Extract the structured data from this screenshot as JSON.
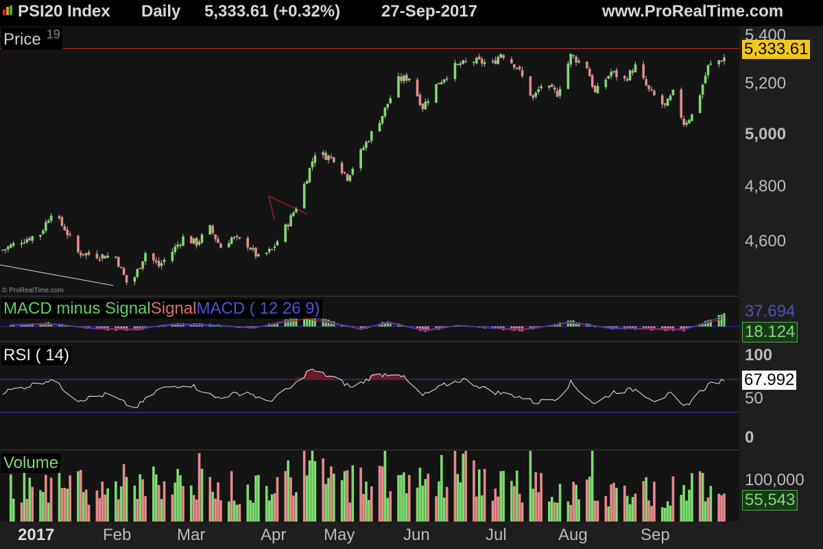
{
  "header": {
    "symbol": "PSI20 Index",
    "interval": "Daily",
    "quote": "5,333.61 (+0.32%)",
    "date": "27-Sep-2017",
    "source": "www.ProRealTime.com"
  },
  "colors": {
    "up": "#7ddc6e",
    "down": "#e88a8a",
    "background": "#141414",
    "signal": "#b02020",
    "macd": "#4040c0",
    "rsi_band": "#3a3ad0",
    "price_line": "#c03030"
  },
  "price_panel": {
    "title": "Price",
    "title_suffix": "19",
    "watermark": "© ProRealTime.com",
    "last_value": "5,333.61",
    "ticks": [
      "5,400",
      "5,200",
      "5,000",
      "4,800",
      "4,600"
    ]
  },
  "macd_panel": {
    "title_hist": "MACD minus Signal",
    "title_signal": "Signal",
    "title_macd": "MACD ( 12 26 9)",
    "tick_top": "37.694",
    "last_value": "18.124"
  },
  "rsi_panel": {
    "title": "RSI ( 14)",
    "ticks": [
      "100",
      "50",
      "0"
    ],
    "last_value": "67.992",
    "overbought": 70,
    "oversold": 30
  },
  "volume_panel": {
    "title": "Volume",
    "tick": "100,000",
    "last_value": "55,543"
  },
  "x_axis": {
    "year": "2017",
    "months": [
      "Feb",
      "Mar",
      "Apr",
      "May",
      "Jun",
      "Jul",
      "Aug",
      "Sep"
    ]
  },
  "chart_data": {
    "type": "candlestick",
    "title": "PSI20 Index",
    "x_range": [
      "2017-01-02",
      "2017-09-27"
    ],
    "price_ylim": [
      4450,
      5450
    ],
    "price_series": {
      "name": "Price",
      "points": [
        [
          "2017-01-02",
          4620
        ],
        [
          "2017-01-09",
          4655
        ],
        [
          "2017-01-16",
          4680
        ],
        [
          "2017-01-20",
          4760
        ],
        [
          "2017-01-25",
          4700
        ],
        [
          "2017-01-30",
          4610
        ],
        [
          "2017-02-06",
          4600
        ],
        [
          "2017-02-13",
          4595
        ],
        [
          "2017-02-17",
          4500
        ],
        [
          "2017-02-20",
          4520
        ],
        [
          "2017-02-24",
          4610
        ],
        [
          "2017-03-01",
          4560
        ],
        [
          "2017-03-06",
          4615
        ],
        [
          "2017-03-10",
          4665
        ],
        [
          "2017-03-15",
          4645
        ],
        [
          "2017-03-20",
          4700
        ],
        [
          "2017-03-24",
          4630
        ],
        [
          "2017-03-28",
          4665
        ],
        [
          "2017-04-03",
          4640
        ],
        [
          "2017-04-07",
          4590
        ],
        [
          "2017-04-12",
          4620
        ],
        [
          "2017-04-18",
          4720
        ],
        [
          "2017-04-21",
          4780
        ],
        [
          "2017-04-25",
          4890
        ],
        [
          "2017-04-28",
          4980
        ],
        [
          "2017-05-05",
          4960
        ],
        [
          "2017-05-10",
          4890
        ],
        [
          "2017-05-16",
          5000
        ],
        [
          "2017-05-23",
          5120
        ],
        [
          "2017-05-29",
          5250
        ],
        [
          "2017-06-02",
          5260
        ],
        [
          "2017-06-07",
          5150
        ],
        [
          "2017-06-12",
          5230
        ],
        [
          "2017-06-19",
          5300
        ],
        [
          "2017-06-26",
          5320
        ],
        [
          "2017-07-03",
          5310
        ],
        [
          "2017-07-06",
          5350
        ],
        [
          "2017-07-12",
          5300
        ],
        [
          "2017-07-18",
          5180
        ],
        [
          "2017-07-21",
          5230
        ],
        [
          "2017-07-27",
          5200
        ],
        [
          "2017-08-01",
          5340
        ],
        [
          "2017-08-07",
          5300
        ],
        [
          "2017-08-10",
          5200
        ],
        [
          "2017-08-16",
          5280
        ],
        [
          "2017-08-21",
          5250
        ],
        [
          "2017-08-25",
          5300
        ],
        [
          "2017-08-30",
          5210
        ],
        [
          "2017-09-05",
          5150
        ],
        [
          "2017-09-08",
          5200
        ],
        [
          "2017-09-12",
          5090
        ],
        [
          "2017-09-15",
          5120
        ],
        [
          "2017-09-18",
          5200
        ],
        [
          "2017-09-21",
          5300
        ],
        [
          "2017-09-27",
          5333.61
        ]
      ]
    },
    "rsi_ylim": [
      0,
      100
    ],
    "rsi_series": {
      "name": "RSI ( 14)",
      "points": [
        [
          "2017-01-02",
          55
        ],
        [
          "2017-01-09",
          60
        ],
        [
          "2017-01-20",
          70
        ],
        [
          "2017-01-30",
          45
        ],
        [
          "2017-02-10",
          52
        ],
        [
          "2017-02-20",
          35
        ],
        [
          "2017-03-01",
          58
        ],
        [
          "2017-03-12",
          65
        ],
        [
          "2017-03-22",
          48
        ],
        [
          "2017-04-03",
          55
        ],
        [
          "2017-04-10",
          42
        ],
        [
          "2017-04-20",
          62
        ],
        [
          "2017-04-26",
          82
        ],
        [
          "2017-05-05",
          72
        ],
        [
          "2017-05-12",
          60
        ],
        [
          "2017-05-20",
          75
        ],
        [
          "2017-05-29",
          78
        ],
        [
          "2017-06-07",
          50
        ],
        [
          "2017-06-14",
          62
        ],
        [
          "2017-06-22",
          70
        ],
        [
          "2017-07-03",
          55
        ],
        [
          "2017-07-12",
          50
        ],
        [
          "2017-07-19",
          42
        ],
        [
          "2017-07-27",
          48
        ],
        [
          "2017-08-01",
          66
        ],
        [
          "2017-08-10",
          40
        ],
        [
          "2017-08-17",
          55
        ],
        [
          "2017-08-25",
          58
        ],
        [
          "2017-09-01",
          45
        ],
        [
          "2017-09-07",
          52
        ],
        [
          "2017-09-12",
          36
        ],
        [
          "2017-09-18",
          55
        ],
        [
          "2017-09-22",
          66
        ],
        [
          "2017-09-27",
          67.992
        ]
      ]
    },
    "macd_ylim": [
      -20,
      40
    ],
    "macd_series": {
      "name": "MACD minus Signal",
      "points": [
        [
          "2017-01-05",
          3
        ],
        [
          "2017-01-20",
          5
        ],
        [
          "2017-02-05",
          -4
        ],
        [
          "2017-02-20",
          -6
        ],
        [
          "2017-03-05",
          4
        ],
        [
          "2017-03-20",
          3
        ],
        [
          "2017-04-05",
          -3
        ],
        [
          "2017-04-25",
          18
        ],
        [
          "2017-05-05",
          6
        ],
        [
          "2017-05-15",
          -5
        ],
        [
          "2017-05-25",
          8
        ],
        [
          "2017-06-08",
          -8
        ],
        [
          "2017-06-20",
          2
        ],
        [
          "2017-07-05",
          -4
        ],
        [
          "2017-07-15",
          -6
        ],
        [
          "2017-08-01",
          8
        ],
        [
          "2017-08-15",
          -3
        ],
        [
          "2017-09-01",
          -5
        ],
        [
          "2017-09-12",
          -6
        ],
        [
          "2017-09-27",
          18.124
        ]
      ]
    },
    "volume_ylim": [
      0,
      140000
    ],
    "volume_series": {
      "name": "Volume",
      "points": [
        [
          "2017-01-05",
          80000
        ],
        [
          "2017-01-20",
          90000
        ],
        [
          "2017-02-05",
          70000
        ],
        [
          "2017-02-20",
          95000
        ],
        [
          "2017-03-05",
          85000
        ],
        [
          "2017-03-20",
          80000
        ],
        [
          "2017-04-05",
          75000
        ],
        [
          "2017-04-18",
          125000
        ],
        [
          "2017-05-05",
          90000
        ],
        [
          "2017-05-22",
          100000
        ],
        [
          "2017-06-05",
          95000
        ],
        [
          "2017-06-19",
          120000
        ],
        [
          "2017-07-05",
          80000
        ],
        [
          "2017-07-20",
          85000
        ],
        [
          "2017-08-05",
          70000
        ],
        [
          "2017-08-20",
          75000
        ],
        [
          "2017-09-05",
          65000
        ],
        [
          "2017-09-20",
          95000
        ],
        [
          "2017-09-27",
          55543
        ]
      ]
    }
  }
}
